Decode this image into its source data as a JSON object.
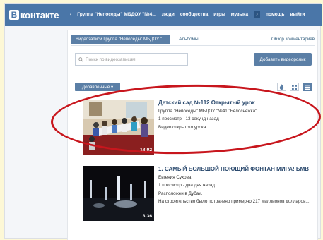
{
  "header": {
    "logo_letter": "В",
    "logo_text": "контакте",
    "nav": {
      "back_arrow": "‹",
      "group": "Группа \"Непоседы\" МБДОУ \"№4...",
      "people": "люди",
      "communities": "сообщества",
      "games": "игры",
      "music": "музыка",
      "more": "›",
      "help": "помощь",
      "logout": "выйти"
    }
  },
  "tabs": {
    "videos": "Видеозаписи Группа \"Непоседы\" МБДОУ \"...",
    "albums": "Альбомы",
    "comments": "Обзор комментариев"
  },
  "search": {
    "placeholder": "Поиск по видеозаписям"
  },
  "add_button": "Добавить видеоролик",
  "toolbar": {
    "sort_label": "Добавленные ▾",
    "view_modes": [
      "fire-icon",
      "grid-icon",
      "list-icon"
    ],
    "active_view": "list"
  },
  "videos": [
    {
      "title": "Детский сад №112 Открытый урок",
      "author": "Группа \"Непоседы\" МБДОУ \"№41 \"Белоснежка\"",
      "stats": "1 просмотр  ·  13 секунд назад",
      "description": "Видео открытого урока",
      "duration": "18:02"
    },
    {
      "title": "1. САМЫЙ БОЛЬШОЙ ПОЮЩИЙ ФОНТАН МИРА! БМВ",
      "author": "Евгения Сухова",
      "stats": "1 просмотр  ·  два дня назад",
      "location": "Расположен в Дубаи.",
      "description": "На строительство было потрачено примерно 217 миллионов долларов...",
      "duration": "3:36"
    }
  ],
  "colors": {
    "brand": "#4a76a8",
    "button": "#5b7fa6",
    "highlight": "#c8161d",
    "background": "#fdf8d6"
  }
}
